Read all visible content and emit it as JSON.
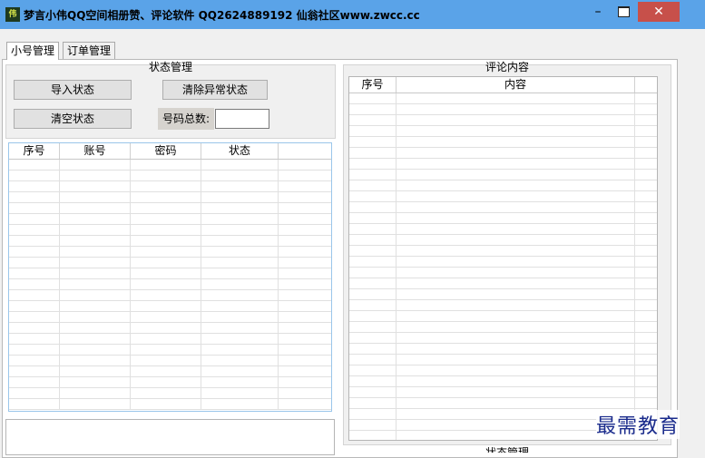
{
  "window": {
    "icon_text": "伟",
    "title": "梦言小伟QQ空间相册赞、评论软件 QQ2624889192  仙翁社区www.zwcc.cc",
    "minimize_glyph": "–",
    "close_glyph": "✕"
  },
  "tabs": [
    {
      "label": "小号管理"
    },
    {
      "label": "订单管理"
    }
  ],
  "status_group": {
    "title": "状态管理",
    "import_button": "导入状态",
    "clear_abnormal_button": "清除异常状态",
    "clear_button": "清空状态",
    "total_label": "号码总数:",
    "total_value": ""
  },
  "accounts_table": {
    "columns": [
      "序号",
      "账号",
      "密码",
      "状态"
    ]
  },
  "comment_group": {
    "title": "评论内容",
    "columns": [
      "序号",
      "内容"
    ]
  },
  "bottom_group_title": "状态管理",
  "watermark": "最需教育",
  "colors": {
    "titlebar": "#5aa3e8",
    "close_button": "#c7504a",
    "grid_border_active": "#9ac6ea",
    "watermark": "#1a2b8c"
  }
}
